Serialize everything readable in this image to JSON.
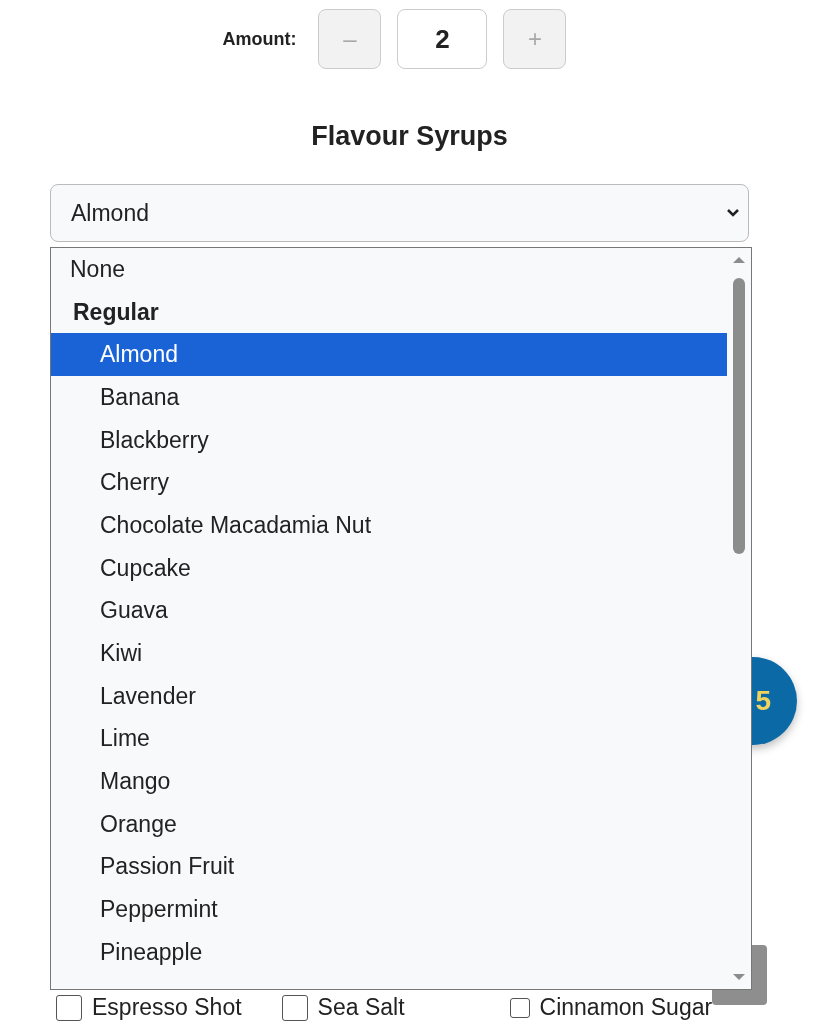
{
  "amount": {
    "label": "Amount:",
    "decrement": {
      "label": "–",
      "disabled": true
    },
    "value": "2",
    "increment": {
      "label": "+",
      "disabled": true
    }
  },
  "heading": "Flavour Syrups",
  "select": {
    "value": "Almond"
  },
  "options": [
    {
      "kind": "option",
      "label": "None",
      "selected": false
    },
    {
      "kind": "group",
      "label": "Regular"
    },
    {
      "kind": "option",
      "label": "Almond",
      "selected": true
    },
    {
      "kind": "option",
      "label": "Banana",
      "selected": false
    },
    {
      "kind": "option",
      "label": "Blackberry",
      "selected": false
    },
    {
      "kind": "option",
      "label": "Cherry",
      "selected": false
    },
    {
      "kind": "option",
      "label": "Chocolate Macadamia Nut",
      "selected": false
    },
    {
      "kind": "option",
      "label": "Cupcake",
      "selected": false
    },
    {
      "kind": "option",
      "label": "Guava",
      "selected": false
    },
    {
      "kind": "option",
      "label": "Kiwi",
      "selected": false
    },
    {
      "kind": "option",
      "label": "Lavender",
      "selected": false
    },
    {
      "kind": "option",
      "label": "Lime",
      "selected": false
    },
    {
      "kind": "option",
      "label": "Mango",
      "selected": false
    },
    {
      "kind": "option",
      "label": "Orange",
      "selected": false
    },
    {
      "kind": "option",
      "label": "Passion Fruit",
      "selected": false
    },
    {
      "kind": "option",
      "label": "Peppermint",
      "selected": false
    },
    {
      "kind": "option",
      "label": "Pineapple",
      "selected": false
    }
  ],
  "price_badge": "5",
  "extras": [
    {
      "label": "Espresso Shot",
      "checked": false
    },
    {
      "label": "Sea Salt",
      "checked": false
    },
    {
      "label": "Cinnamon Sugar",
      "checked": false
    }
  ]
}
